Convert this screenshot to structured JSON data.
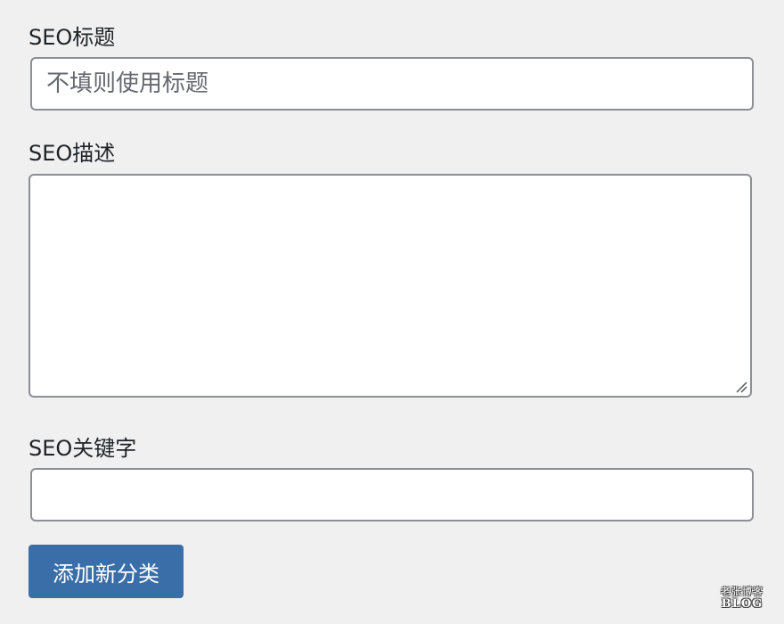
{
  "form": {
    "seo_title": {
      "label": "SEO标题",
      "placeholder": "不填则使用标题",
      "value": ""
    },
    "seo_description": {
      "label": "SEO描述",
      "value": ""
    },
    "seo_keywords": {
      "label": "SEO关键字",
      "value": ""
    },
    "submit_label": "添加新分类"
  },
  "watermark": {
    "top_text": "老张博客",
    "bottom_text": "BLOG"
  },
  "colors": {
    "background": "#f0f0f1",
    "button": "#3a6ea8",
    "field_border": "#8c8f94"
  }
}
